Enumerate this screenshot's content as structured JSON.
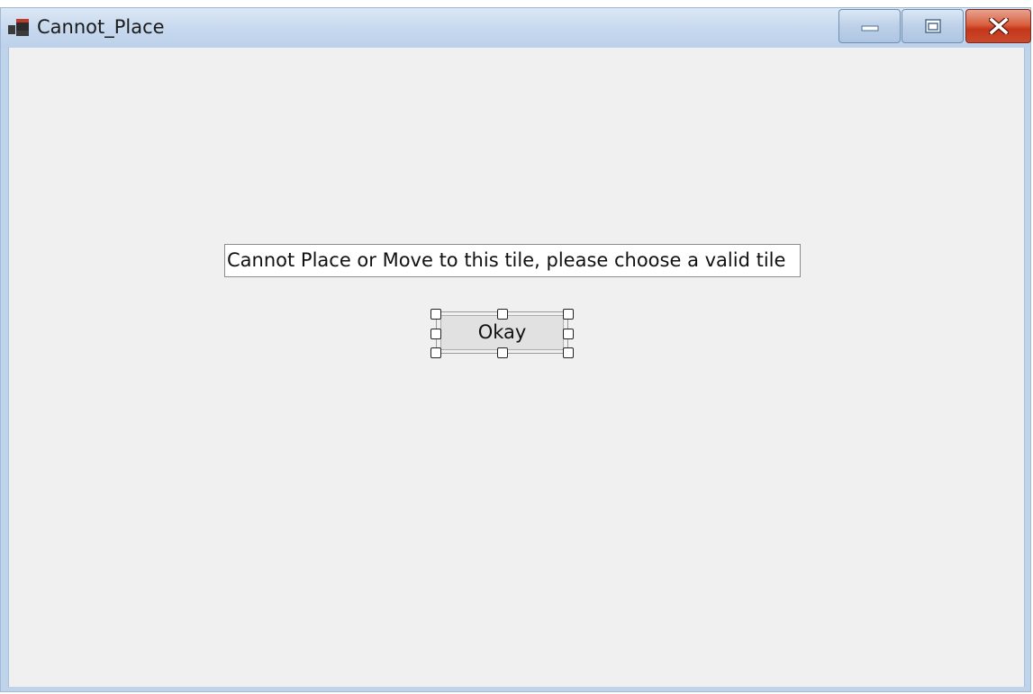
{
  "window": {
    "title": "Cannot_Place",
    "icon": "app-window-icon",
    "controls": {
      "minimize_icon": "minimize-icon",
      "maximize_icon": "maximize-icon",
      "close_icon": "close-icon",
      "close_color": "#c9452a"
    }
  },
  "dialog": {
    "message": "Cannot Place or Move to this tile, please choose a valid tile",
    "okay_button_label": "Okay",
    "okay_button_state": "selected-in-designer",
    "background_color": "#f0f0f0"
  }
}
